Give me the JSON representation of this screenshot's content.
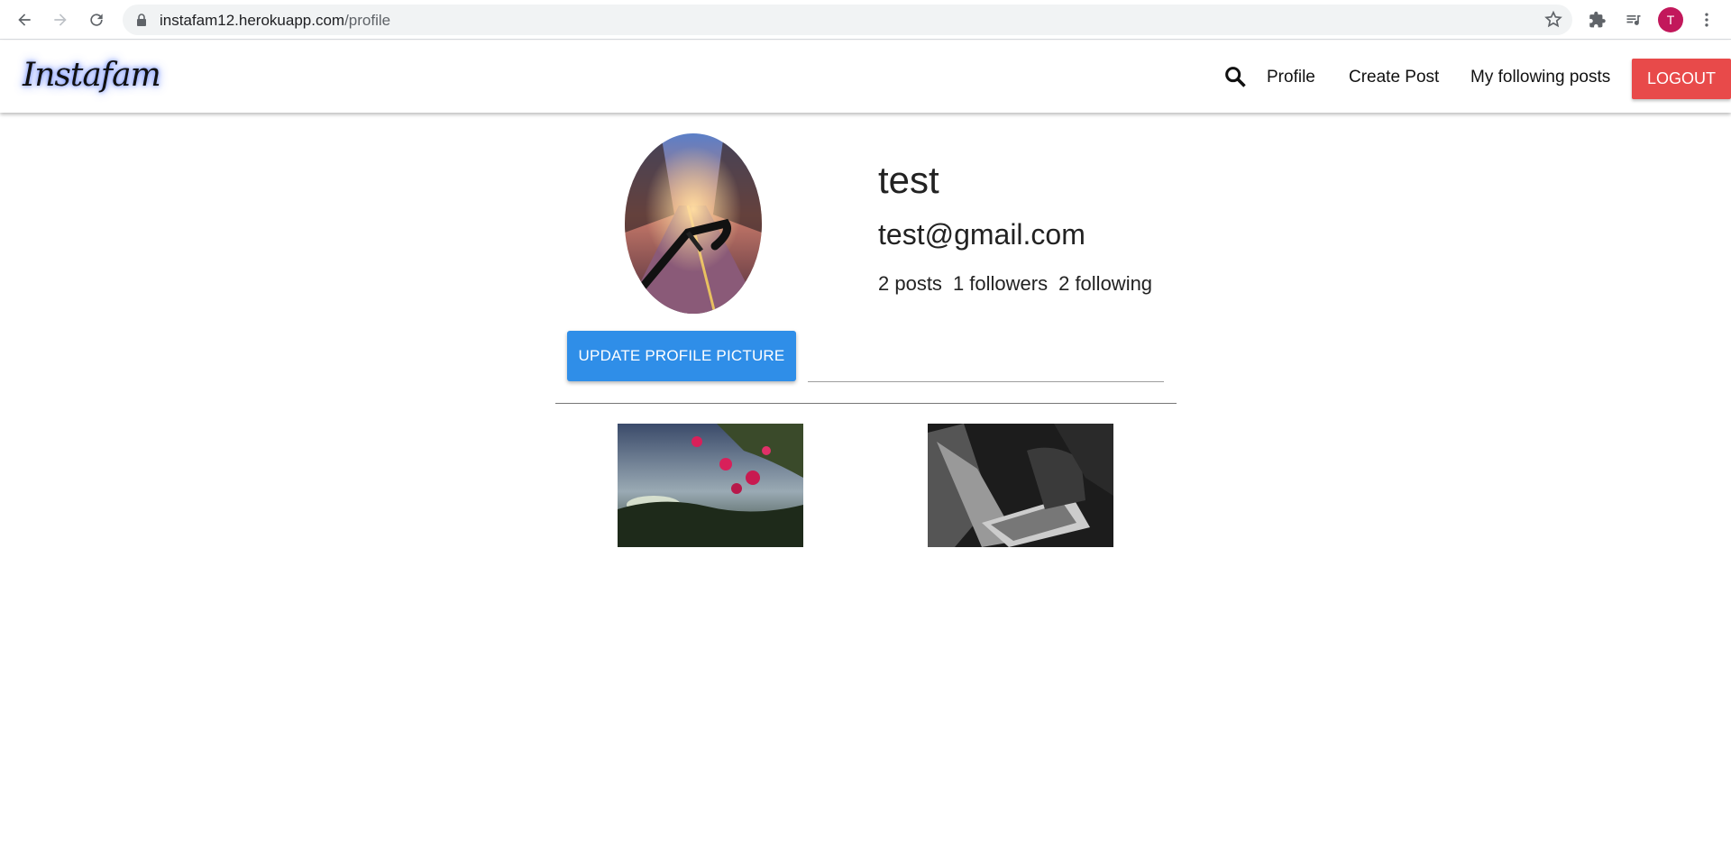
{
  "browser": {
    "url_host": "instafam12.herokuapp.com",
    "url_path": "/profile",
    "profile_initial": "T",
    "icons": [
      "back-icon",
      "forward-icon",
      "reload-icon",
      "lock-icon",
      "star-icon",
      "extensions-icon",
      "media-icon",
      "menu-icon"
    ]
  },
  "navbar": {
    "brand": "Instafam",
    "links": [
      "Profile",
      "Create Post",
      "My following posts"
    ],
    "logout": "LOGOUT",
    "search_icon": "search-icon"
  },
  "profile": {
    "username": "test",
    "email": "test@gmail.com",
    "posts": "2 posts",
    "followers": "1 followers",
    "following": "2 following",
    "update_button": "UPDATE PROFILE PICTURE"
  },
  "colors": {
    "logout": "#e84a4a",
    "update_button": "#2f8ee8",
    "avatar": "#c2185b"
  }
}
